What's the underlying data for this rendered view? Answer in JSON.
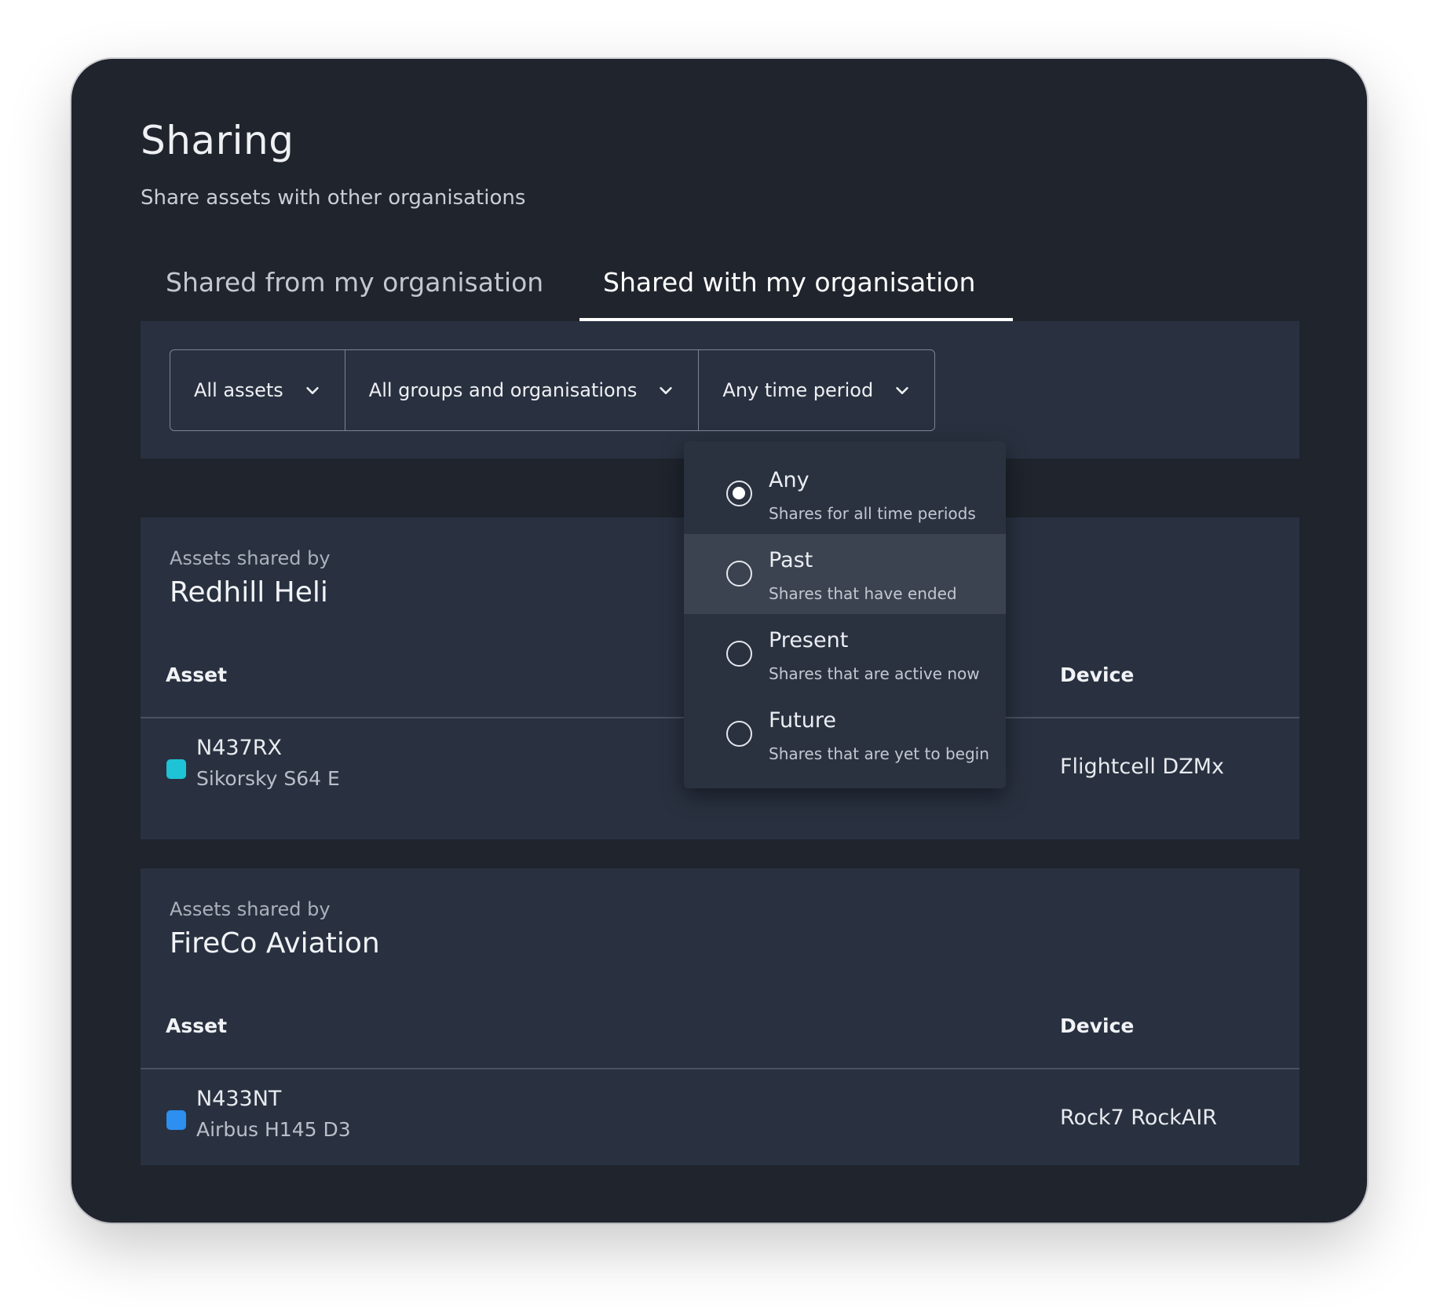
{
  "header": {
    "title": "Sharing",
    "subtitle": "Share assets with other organisations"
  },
  "tabs": [
    {
      "label": "Shared from my organisation",
      "active": false
    },
    {
      "label": "Shared with my organisation",
      "active": true
    }
  ],
  "filters": [
    {
      "label": "All assets",
      "icon": "chevron-down-icon"
    },
    {
      "label": "All groups and organisations",
      "icon": "chevron-down-icon"
    },
    {
      "label": "Any time period",
      "icon": "chevron-down-icon"
    }
  ],
  "time_dropdown": {
    "options": [
      {
        "title": "Any",
        "description": "Shares for all time periods",
        "selected": true
      },
      {
        "title": "Past",
        "description": "Shares that have ended",
        "selected": false,
        "hovered": true
      },
      {
        "title": "Present",
        "description": "Shares that are active now",
        "selected": false
      },
      {
        "title": "Future",
        "description": "Shares that are yet to begin",
        "selected": false
      }
    ]
  },
  "shares": [
    {
      "shared_by_label": "Assets shared by",
      "org": "Redhill Heli",
      "columns": {
        "asset": "Asset",
        "device": "Device"
      },
      "assets": [
        {
          "id": "N437RX",
          "model": "Sikorsky S64 E",
          "device": "Flightcell DZMx",
          "color": "#1ec3d6"
        }
      ]
    },
    {
      "shared_by_label": "Assets shared by",
      "org": "FireCo Aviation",
      "columns": {
        "asset": "Asset",
        "device": "Device"
      },
      "assets": [
        {
          "id": "N433NT",
          "model": "Airbus H145 D3",
          "device": "Rock7 RockAIR",
          "color": "#2d8ff0"
        }
      ]
    }
  ]
}
